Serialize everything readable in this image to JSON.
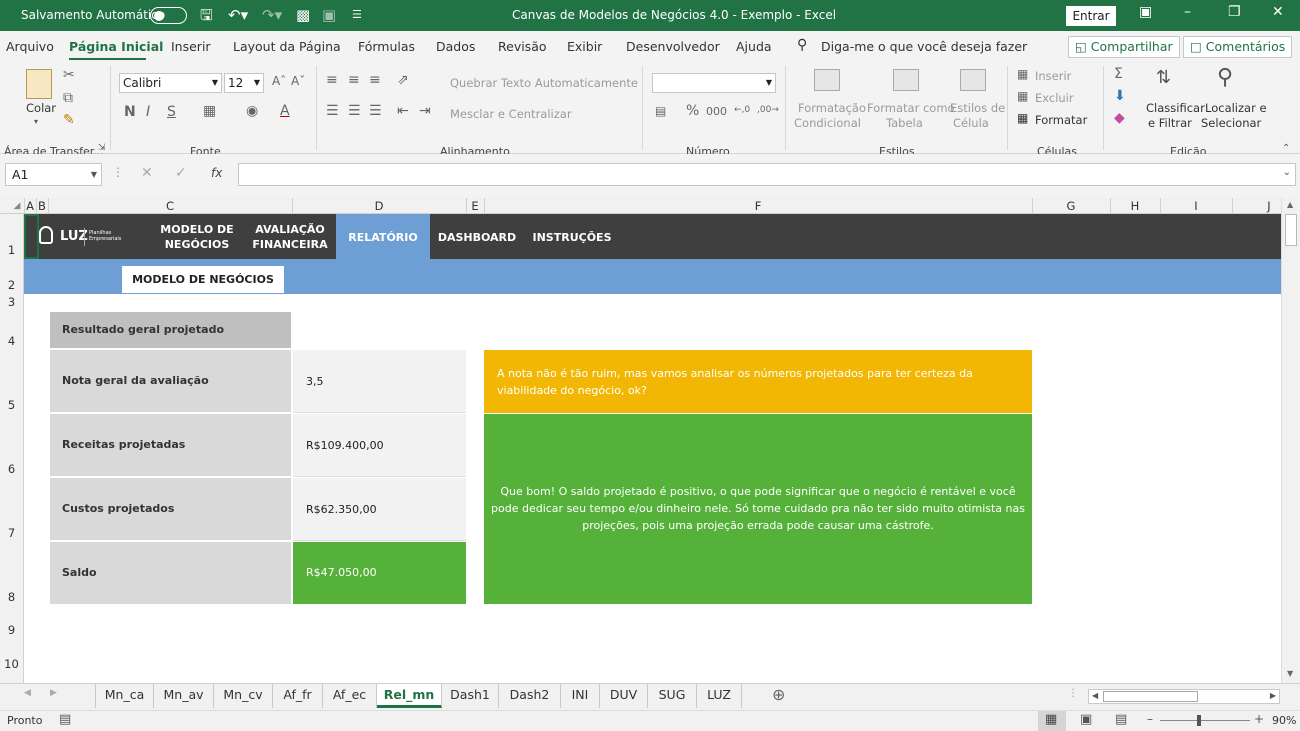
{
  "titlebar": {
    "autosave_label": "Salvamento Automático",
    "title": "Canvas de Modelos de Negócios 4.0 - Exemplo  -  Excel",
    "signin_label": "Entrar"
  },
  "menu": {
    "items": [
      "Arquivo",
      "Página Inicial",
      "Inserir",
      "Layout da Página",
      "Fórmulas",
      "Dados",
      "Revisão",
      "Exibir",
      "Desenvolvedor",
      "Ajuda"
    ],
    "tell_me": "Diga-me o que você deseja fazer",
    "share": "Compartilhar",
    "comments": "Comentários"
  },
  "ribbon": {
    "paste": "Colar",
    "font_name": "Calibri",
    "font_size": "12",
    "wrap_text": "Quebrar Texto Automaticamente",
    "merge_center": "Mesclar e Centralizar",
    "cond_format_1": "Formatação",
    "cond_format_2": "Condicional",
    "format_table_1": "Formatar como",
    "format_table_2": "Tabela",
    "cell_styles_1": "Estilos de",
    "cell_styles_2": "Célula",
    "insert": "Inserir",
    "delete": "Excluir",
    "format": "Formatar",
    "sort_1": "Classificar",
    "sort_2": "e Filtrar",
    "find_1": "Localizar e",
    "find_2": "Selecionar",
    "groups": {
      "clipboard": "Área de Transfer...",
      "font": "Fonte",
      "alignment": "Alinhamento",
      "number": "Número",
      "styles": "Estilos",
      "cells": "Células",
      "editing": "Edição"
    }
  },
  "formula_bar": {
    "name_box": "A1",
    "fx": "fx",
    "formula": ""
  },
  "columns": [
    "A",
    "B",
    "C",
    "D",
    "E",
    "F",
    "G",
    "H",
    "I",
    "J"
  ],
  "rows": [
    "1",
    "2",
    "3",
    "4",
    "5",
    "6",
    "7",
    "8",
    "9",
    "10"
  ],
  "sheet": {
    "logo": "LUZ",
    "logo_sub": "Planilhas Empresariais",
    "nav": [
      {
        "line1": "MODELO DE",
        "line2": "NEGÓCIOS"
      },
      {
        "line1": "AVALIAÇÃO",
        "line2": "FINANCEIRA"
      },
      {
        "line1": "RELATÓRIO",
        "line2": ""
      },
      {
        "line1": "DASHBOARD",
        "line2": ""
      },
      {
        "line1": "INSTRUÇÕES",
        "line2": ""
      }
    ],
    "subtab": "MODELO DE NEGÓCIOS",
    "result_header": "Resultado geral projetado",
    "labels": [
      "Nota geral da avaliação",
      "Receitas projetadas",
      "Custos projetados",
      "Saldo"
    ],
    "values": [
      "3,5",
      "R$109.400,00",
      "R$62.350,00",
      "R$47.050,00"
    ],
    "msg_warning": "A nota não é tão ruim, mas vamos analisar os números projetados para ter certeza da viabilidade do negócio, ok?",
    "msg_success": "Que bom! O saldo projetado é positivo, o que pode significar que o negócio é rentável e você pode dedicar seu tempo e/ou dinheiro nele. Só tome cuidado pra não ter sido muito otimista nas projeções, pois uma projeção errada pode causar uma cástrofe."
  },
  "sheet_tabs": [
    "Mn_ca",
    "Mn_av",
    "Mn_cv",
    "Af_fr",
    "Af_ec",
    "Rel_mn",
    "Dash1",
    "Dash2",
    "INI",
    "DUV",
    "SUG",
    "LUZ"
  ],
  "active_tab": "Rel_mn",
  "status": {
    "mode": "Pronto",
    "zoom": "90%"
  },
  "colors": {
    "excel_green": "#217346",
    "nav_dark": "#3f3f3f",
    "nav_blue": "#6d9fd4",
    "warning": "#f2b705",
    "success": "#56b13b"
  }
}
